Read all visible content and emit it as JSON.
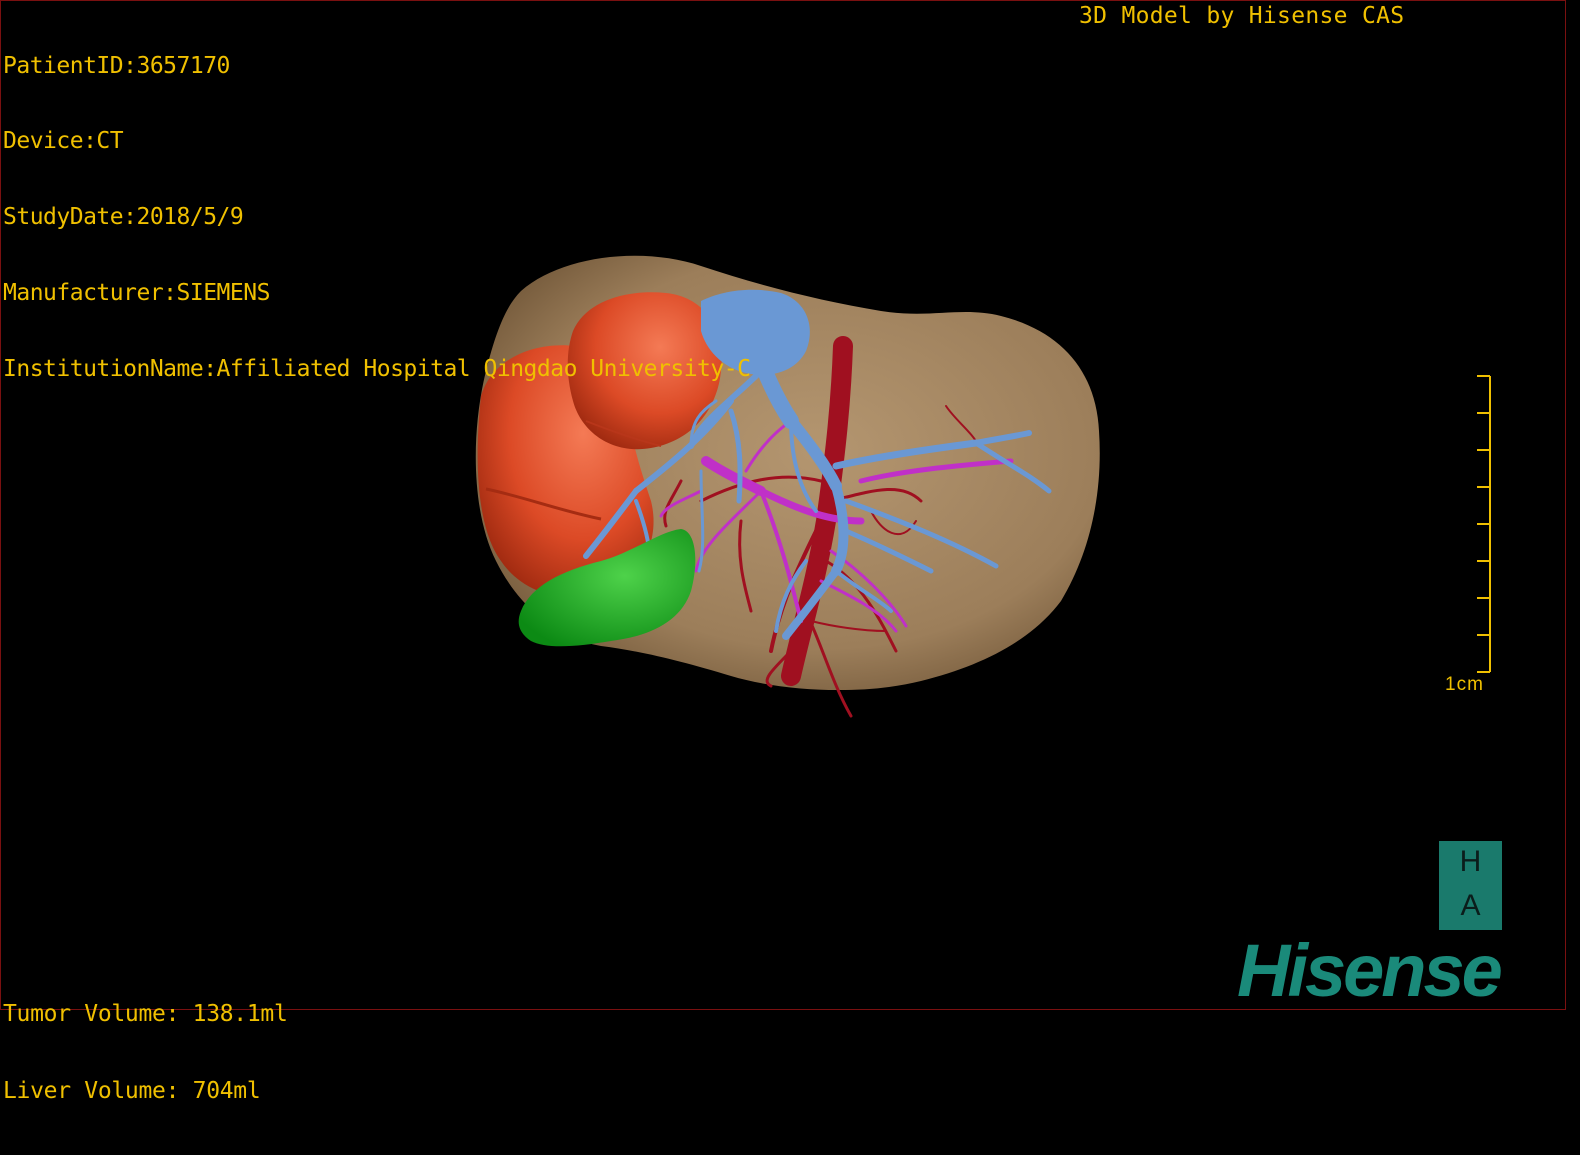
{
  "header": {
    "patient_id": "PatientID:3657170",
    "device": "Device:CT",
    "study_date": "StudyDate:2018/5/9",
    "manufacturer": "Manufacturer:SIEMENS",
    "institution": "InstitutionName:Affiliated Hospital Qingdao University-C"
  },
  "brand_caption": "3D Model by Hisense CAS",
  "volumes": {
    "tumor": "Tumor Volume: 138.1ml",
    "liver": "Liver Volume: 704ml"
  },
  "scale_bar": {
    "label": "1cm",
    "ticks": 9
  },
  "orientation": {
    "top": "H",
    "bottom": "A"
  },
  "logo": "Hisense",
  "model": {
    "structures": [
      {
        "name": "liver",
        "color": "#a88a66"
      },
      {
        "name": "tumor",
        "color": "#e0502c"
      },
      {
        "name": "portal-vein",
        "color": "#6a98d4"
      },
      {
        "name": "hepatic-artery",
        "color": "#a01020"
      },
      {
        "name": "hepatic-vein",
        "color": "#c030c8"
      },
      {
        "name": "gallbladder",
        "color": "#1aa020"
      }
    ]
  },
  "colors": {
    "text": "#f0c000",
    "background": "#000000",
    "brand": "#1a8a7a"
  }
}
